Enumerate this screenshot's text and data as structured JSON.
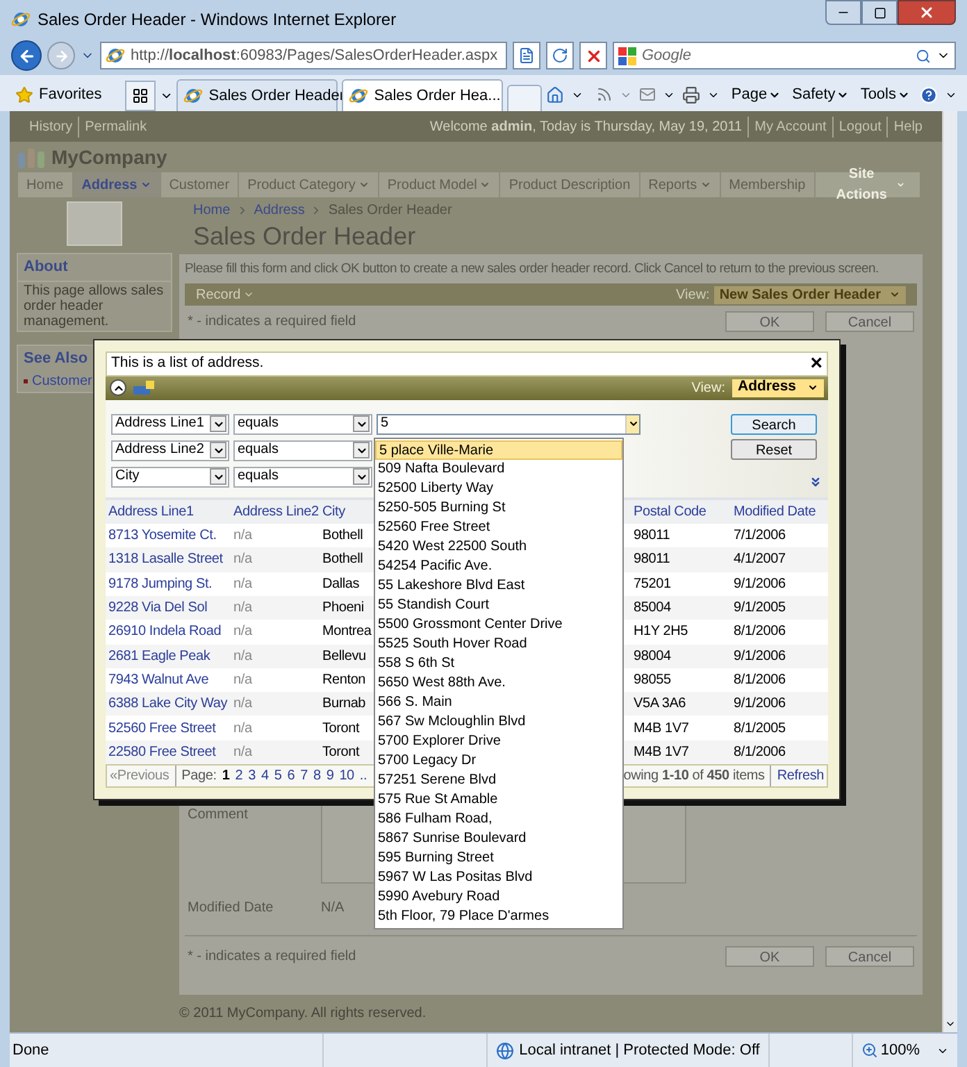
{
  "browser": {
    "title": "Sales Order Header - Windows Internet Explorer",
    "address": "http://**localhost**:60983/Pages/SalesOrderHeader.aspx",
    "search_placeholder": "Google",
    "favorites": "Favorites",
    "tabs": [
      {
        "label": "Sales Order Header",
        "selected": false
      },
      {
        "label": "Sales Order Hea...",
        "selected": true
      }
    ],
    "commands": [
      "Page",
      "Safety",
      "Tools"
    ]
  },
  "page": {
    "top_links": [
      "History",
      "Permalink"
    ],
    "welcome": "Welcome **admin**, Today is Thursday, May 19, 2011",
    "account_links": [
      "My Account",
      "Logout",
      "Help"
    ],
    "logo": "MyCompany",
    "menu": [
      {
        "label": "Home",
        "selected": false,
        "has_menu": false
      },
      {
        "label": "Address",
        "selected": true,
        "has_menu": true
      },
      {
        "label": "Customer",
        "selected": false,
        "has_menu": false
      },
      {
        "label": "Product Category",
        "selected": false,
        "has_menu": true
      },
      {
        "label": "Product Model",
        "selected": false,
        "has_menu": true
      },
      {
        "label": "Product Description",
        "selected": false,
        "has_menu": false
      },
      {
        "label": "Reports",
        "selected": false,
        "has_menu": true
      },
      {
        "label": "Membership",
        "selected": false,
        "has_menu": false
      }
    ],
    "site_actions": "Site Actions",
    "sidebar": {
      "about_title": "About",
      "about_text": "This page allows sales order header management.",
      "see_also_title": "See Also",
      "see_also_items": [
        "Customer"
      ]
    },
    "breadcrumb": [
      "Home",
      "Address",
      "Sales Order Header"
    ],
    "title": "Sales Order Header",
    "instruction": "Please fill this form and click OK button to create a new sales order header record. Click Cancel to return to the previous screen.",
    "record_menu": "Record",
    "view_label": "View:",
    "view_value": "New Sales Order Header",
    "required_note": "* - indicates a required field",
    "buttons": [
      "OK",
      "Cancel"
    ],
    "fields": [
      {
        "label": "Comment",
        "kind": "textarea"
      },
      {
        "label": "Modified Date",
        "kind": "text",
        "value": "N/A"
      }
    ],
    "required_note_bottom": "* - indicates a required field",
    "buttons_bottom": [
      "OK",
      "Cancel"
    ],
    "copyright": "© 2011 MyCompany. All rights reserved."
  },
  "dialog": {
    "description": "This is a list of address.",
    "close": "×",
    "view_label": "View:",
    "view_value": "Address",
    "filters": [
      {
        "field": "Address Line1",
        "operator": "equals",
        "value": "5"
      },
      {
        "field": "Address Line2",
        "operator": "equals"
      },
      {
        "field": "City",
        "operator": "equals"
      }
    ],
    "search": "Search",
    "reset": "Reset",
    "columns": [
      "Address Line1",
      "Address Line2",
      "City",
      "Postal Code",
      "Modified Date"
    ],
    "rows": [
      [
        "8713 Yosemite Ct.",
        "n/a",
        "Bothell",
        "98011",
        "7/1/2006"
      ],
      [
        "1318 Lasalle Street",
        "n/a",
        "Bothell",
        "98011",
        "4/1/2007"
      ],
      [
        "9178 Jumping St.",
        "n/a",
        "Dallas",
        "75201",
        "9/1/2006"
      ],
      [
        "9228 Via Del Sol",
        "n/a",
        "Phoeni",
        "85004",
        "9/1/2005"
      ],
      [
        "26910 Indela Road",
        "n/a",
        "Montrea",
        "H1Y 2H5",
        "8/1/2006"
      ],
      [
        "2681 Eagle Peak",
        "n/a",
        "Bellevu",
        "98004",
        "9/1/2006"
      ],
      [
        "7943 Walnut Ave",
        "n/a",
        "Renton",
        "98055",
        "8/1/2006"
      ],
      [
        "6388 Lake City Way",
        "n/a",
        "Burnab",
        "V5A 3A6",
        "9/1/2006"
      ],
      [
        "52560 Free Street",
        "n/a",
        "Toront",
        "M4B 1V7",
        "8/1/2005"
      ],
      [
        "22580 Free Street",
        "n/a",
        "Toront",
        "M4B 1V7",
        "8/1/2006"
      ]
    ],
    "pager": {
      "previous": "«Previous",
      "page_label": "Page:",
      "pages": [
        {
          "label": "1",
          "selected": true
        },
        {
          "label": "2",
          "selected": false
        },
        {
          "label": "3",
          "selected": false
        },
        {
          "label": "4",
          "selected": false
        },
        {
          "label": "5",
          "selected": false
        },
        {
          "label": "6",
          "selected": false
        },
        {
          "label": "7",
          "selected": false
        },
        {
          "label": "8",
          "selected": false
        },
        {
          "label": "9",
          "selected": false
        },
        {
          "label": "10",
          "selected": false
        }
      ],
      "more": "..",
      "summary": "owing **1-10** of **450** items",
      "refresh": "Refresh"
    }
  },
  "autocomplete": {
    "items": [
      {
        "label": "5 place Ville-Marie",
        "selected": true
      },
      {
        "label": "509 Nafta Boulevard",
        "selected": false
      },
      {
        "label": "52500 Liberty Way",
        "selected": false
      },
      {
        "label": "5250-505 Burning St",
        "selected": false
      },
      {
        "label": "52560 Free Street",
        "selected": false
      },
      {
        "label": "5420 West 22500 South",
        "selected": false
      },
      {
        "label": "54254 Pacific Ave.",
        "selected": false
      },
      {
        "label": "55 Lakeshore Blvd East",
        "selected": false
      },
      {
        "label": "55 Standish Court",
        "selected": false
      },
      {
        "label": "5500 Grossmont Center Drive",
        "selected": false
      },
      {
        "label": "5525 South Hover Road",
        "selected": false
      },
      {
        "label": "558 S 6th St",
        "selected": false
      },
      {
        "label": "5650 West 88th Ave.",
        "selected": false
      },
      {
        "label": "566 S. Main",
        "selected": false
      },
      {
        "label": "567 Sw Mcloughlin Blvd",
        "selected": false
      },
      {
        "label": "5700 Explorer Drive",
        "selected": false
      },
      {
        "label": "5700 Legacy Dr",
        "selected": false
      },
      {
        "label": "57251 Serene Blvd",
        "selected": false
      },
      {
        "label": "575 Rue St Amable",
        "selected": false
      },
      {
        "label": "586 Fulham Road,",
        "selected": false
      },
      {
        "label": "5867 Sunrise Boulevard",
        "selected": false
      },
      {
        "label": "595 Burning Street",
        "selected": false
      },
      {
        "label": "5967 W Las Positas Blvd",
        "selected": false
      },
      {
        "label": "5990 Avebury Road",
        "selected": false
      },
      {
        "label": "5th Floor, 79 Place D'armes",
        "selected": false
      }
    ]
  },
  "status_bar": {
    "text": "Done",
    "zone": "Local intranet | Protected Mode: Off",
    "zoom": "100%"
  }
}
